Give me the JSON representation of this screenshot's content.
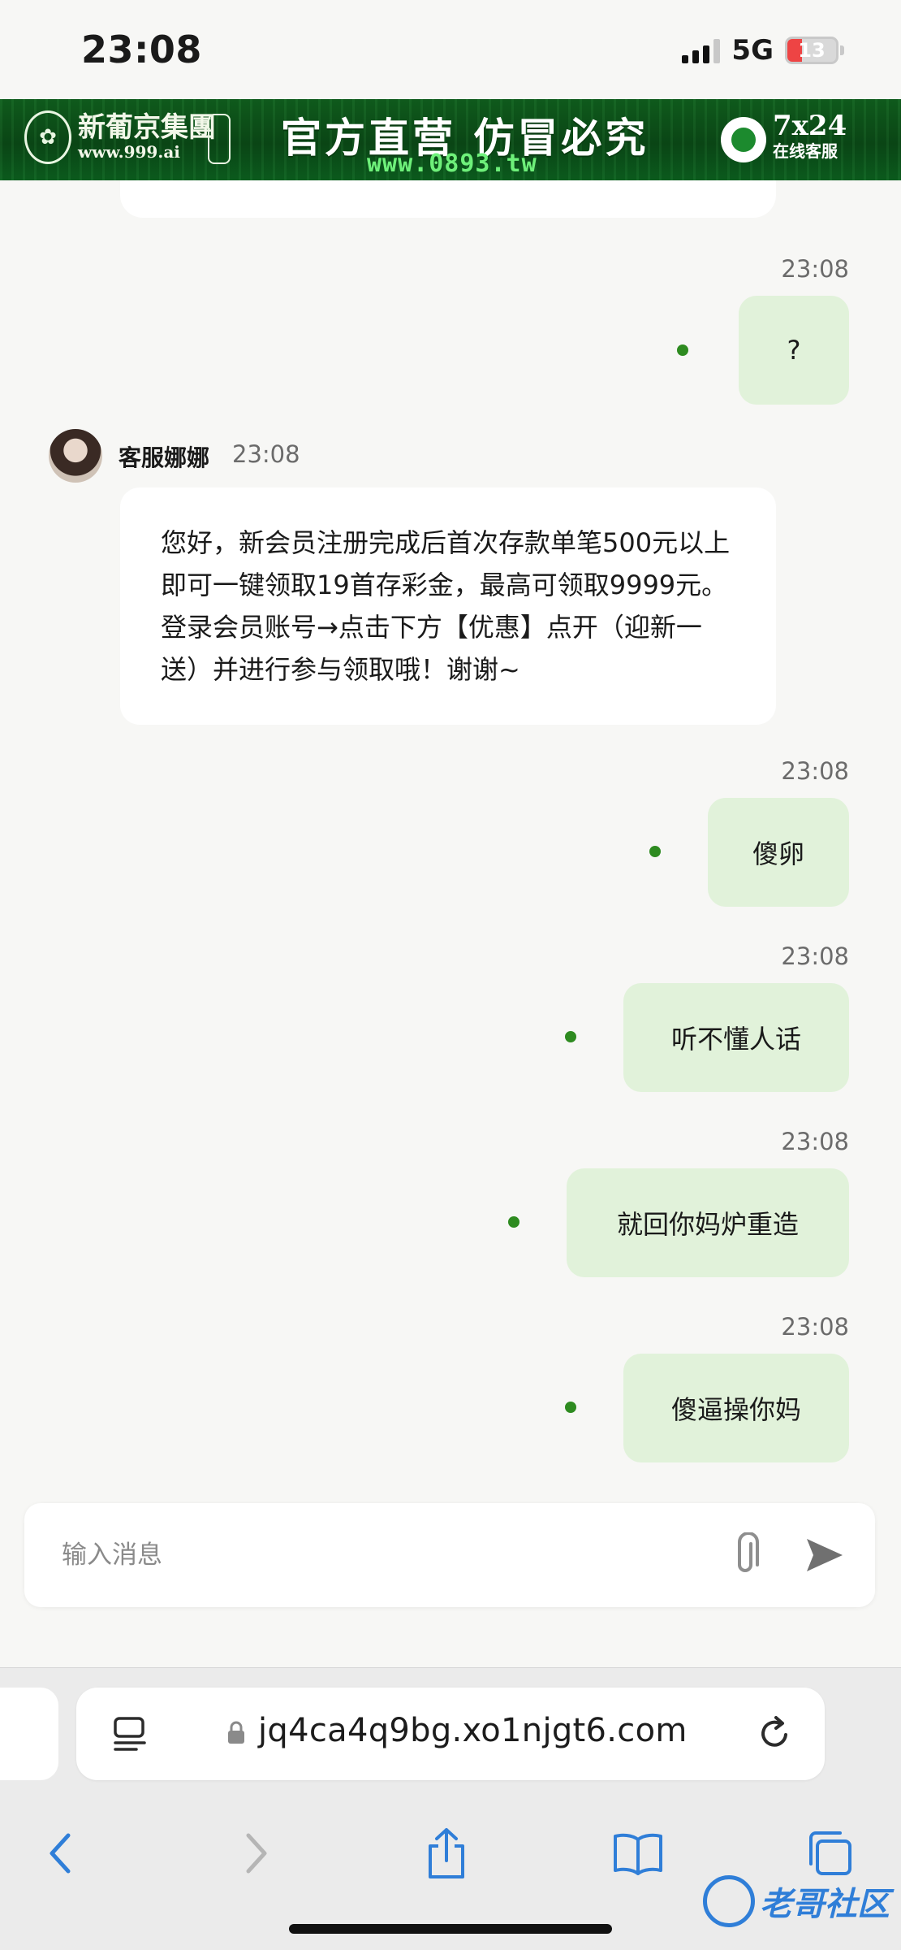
{
  "status_bar": {
    "time": "23:08",
    "network": "5G",
    "battery": "13"
  },
  "banner": {
    "brand_name": "新葡京集團",
    "brand_url": "www.999.ai",
    "slogan": "官方直营  仿冒必究",
    "scroll_url": "www.0893.tw",
    "service_hours": "7x24",
    "service_label": "在线客服"
  },
  "messages": [
    {
      "type": "out",
      "time": "23:08",
      "text": "?"
    },
    {
      "type": "in",
      "sender": "客服娜娜",
      "time": "23:08",
      "text": "您好，新会员注册完成后首次存款单笔500元以上即可一键领取19首存彩金，最高可领取9999元。登录会员账号→点击下方【优惠】点开（迎新一送）并进行参与领取哦！谢谢~"
    },
    {
      "type": "out",
      "time": "23:08",
      "text": "傻卵"
    },
    {
      "type": "out",
      "time": "23:08",
      "text": "听不懂人话"
    },
    {
      "type": "out",
      "time": "23:08",
      "text": "就回你妈炉重造"
    },
    {
      "type": "out",
      "time": "23:08",
      "text": "傻逼操你妈"
    }
  ],
  "composer": {
    "placeholder": "输入消息"
  },
  "browser": {
    "url": "jq4ca4q9bg.xo1njgt6.com"
  },
  "watermark": "老哥社区",
  "colors": {
    "outgoing_bubble": "#e1f2da",
    "status_dot": "#2e8b20",
    "banner_green": "#0a4515",
    "link_blue": "#2f7ed8"
  }
}
